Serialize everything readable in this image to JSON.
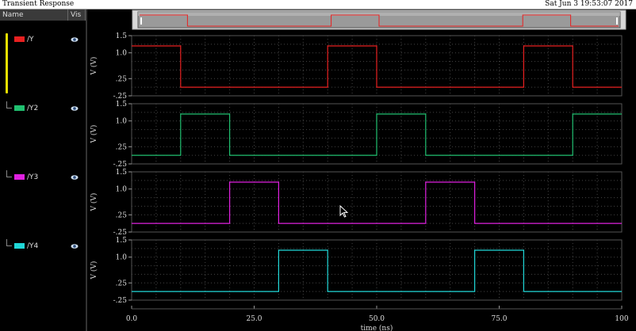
{
  "window": {
    "title": "Transient Response",
    "timestamp": "Sat Jun 3 19:53:07 2017"
  },
  "sidebar": {
    "headers": {
      "name": "Name",
      "vis": "Vis"
    },
    "items": [
      {
        "label": "/Y",
        "color": "#e82020"
      },
      {
        "label": "/Y2",
        "color": "#20c070"
      },
      {
        "label": "/Y3",
        "color": "#e020e0"
      },
      {
        "label": "/Y4",
        "color": "#20d8d8"
      }
    ]
  },
  "panels": {
    "ylabel": "V (V)",
    "yticks": [
      "1.5",
      "1.0",
      ".25",
      "-.25"
    ]
  },
  "chart_data": {
    "type": "line",
    "xlabel": "time (ns)",
    "xlim": [
      0,
      100
    ],
    "xticks": [
      "0.0",
      "25.0",
      "50.0",
      "75.0",
      "100"
    ],
    "ylabel": "V (V)",
    "ylim": [
      -0.25,
      1.5
    ],
    "low": 0.0,
    "high": 1.2,
    "series": [
      {
        "name": "/Y",
        "color": "#e82020",
        "t": [
          0,
          10,
          40,
          50,
          80,
          90,
          100
        ],
        "v": [
          1.2,
          0.0,
          1.2,
          0.0,
          1.2,
          0.0,
          0.0
        ]
      },
      {
        "name": "/Y2",
        "color": "#20c070",
        "t": [
          0,
          10,
          20,
          50,
          60,
          90,
          100
        ],
        "v": [
          0.0,
          1.2,
          0.0,
          1.2,
          0.0,
          1.2,
          1.2
        ]
      },
      {
        "name": "/Y3",
        "color": "#e020e0",
        "t": [
          0,
          20,
          30,
          60,
          70,
          100
        ],
        "v": [
          0.0,
          1.2,
          0.0,
          1.2,
          0.0,
          0.0
        ]
      },
      {
        "name": "/Y4",
        "color": "#20d8d8",
        "t": [
          0,
          30,
          40,
          70,
          80,
          100
        ],
        "v": [
          0.0,
          1.2,
          0.0,
          1.2,
          0.0,
          0.0
        ]
      }
    ]
  }
}
